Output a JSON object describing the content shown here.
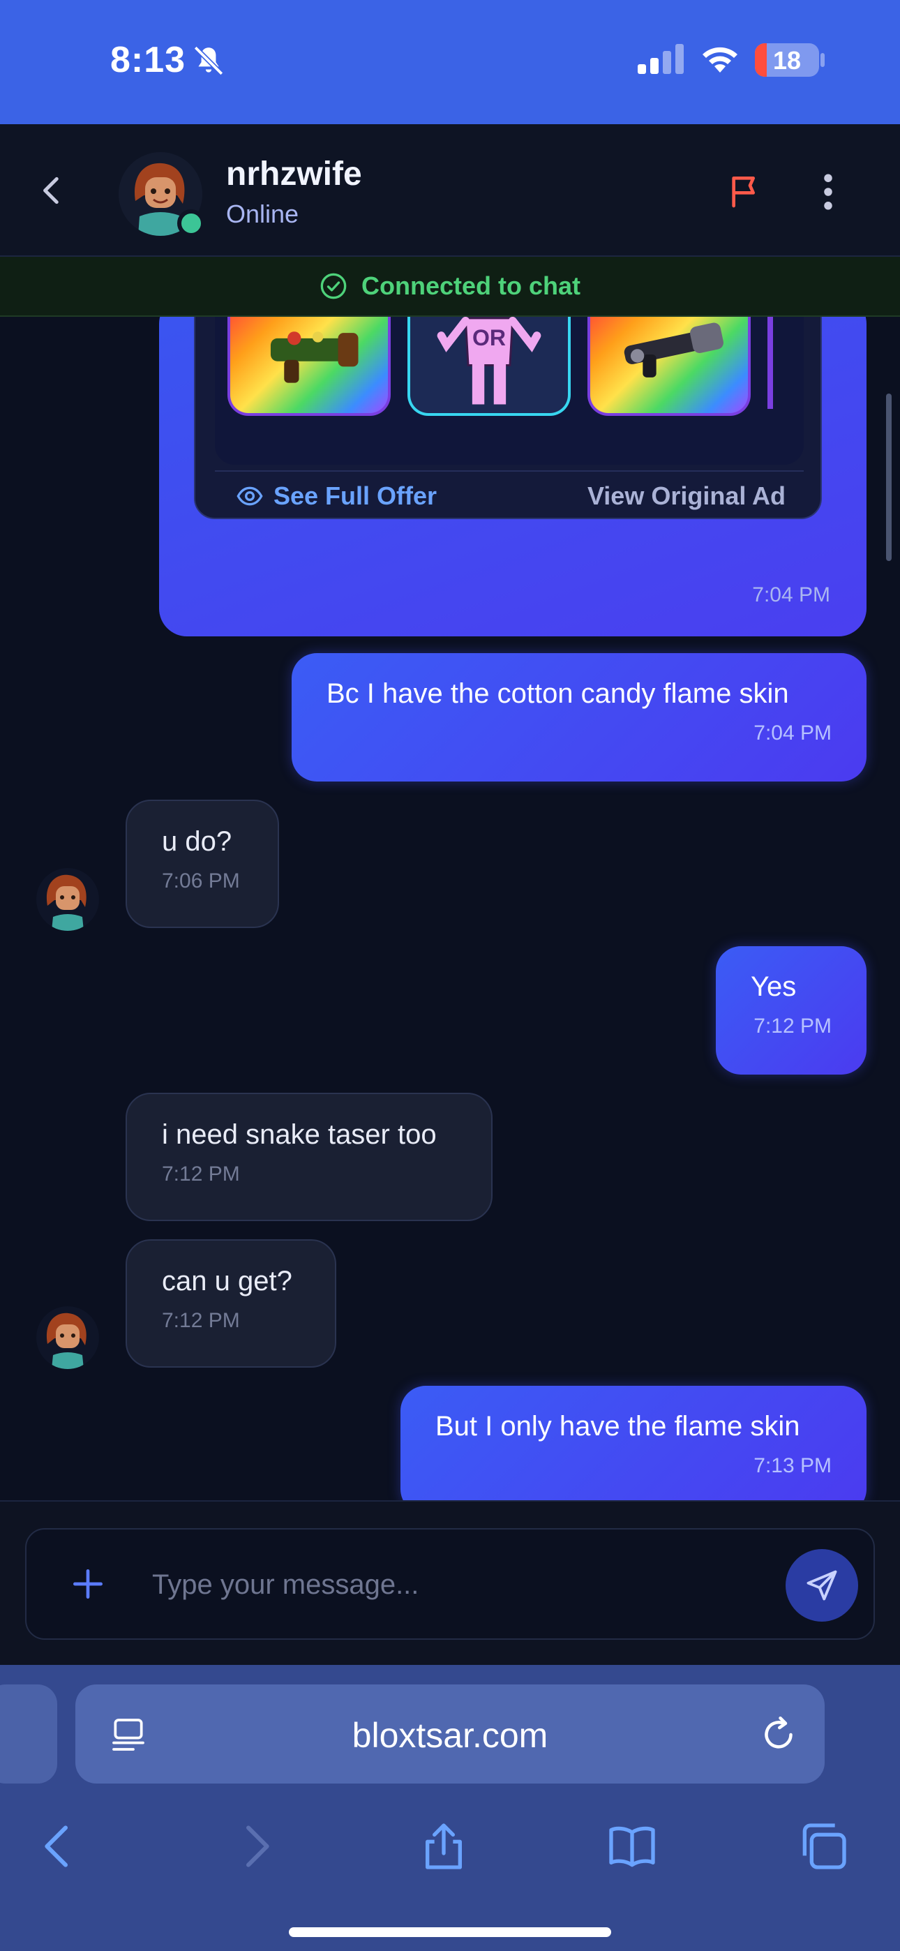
{
  "status_bar": {
    "time": "8:13",
    "battery": "18",
    "icons": [
      "bell-slash-icon",
      "signal-icon",
      "wifi-icon",
      "battery-icon"
    ]
  },
  "chat_header": {
    "username": "nrhzwife",
    "status": "Online"
  },
  "banner": {
    "text": "Connected to chat"
  },
  "offer": {
    "item_badge": "OR",
    "see_full_label": "See Full Offer",
    "view_ad_label": "View Original Ad",
    "time": "7:04 PM"
  },
  "messages": [
    {
      "side": "sent",
      "text": "Bc I have the cotton candy flame skin",
      "time": "7:04 PM"
    },
    {
      "side": "received",
      "text": "u do?",
      "time": "7:06 PM"
    },
    {
      "side": "sent",
      "text": "Yes",
      "time": "7:12 PM"
    },
    {
      "side": "received",
      "text": "i need snake taser too",
      "time": "7:12 PM"
    },
    {
      "side": "received",
      "text": "can u get?",
      "time": "7:12 PM"
    },
    {
      "side": "sent",
      "text": "But I only have the flame skin",
      "time": "7:13 PM"
    }
  ],
  "composer": {
    "placeholder": "Type your message..."
  },
  "browser": {
    "url": "bloxtsar.com"
  },
  "colors": {
    "accent": "#3b5cf5",
    "online": "#3cc596",
    "connected": "#4ed27a",
    "flag": "#ff5a4a"
  }
}
